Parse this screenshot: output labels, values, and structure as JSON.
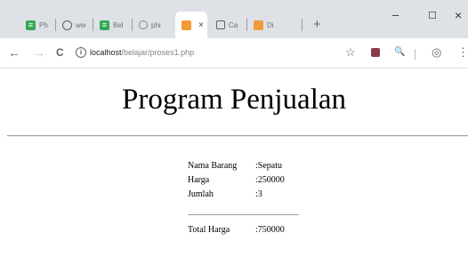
{
  "browser": {
    "tabs": [
      {
        "label": "Ph",
        "color": "#34a853",
        "glyph": "≡",
        "active": false
      },
      {
        "label": "ww",
        "color": "#5f6368",
        "glyph": "◎",
        "active": false
      },
      {
        "label": "Bel",
        "color": "#34a853",
        "glyph": "≡",
        "active": false
      },
      {
        "label": "phi",
        "color": "#5f6368",
        "glyph": "○",
        "active": false
      },
      {
        "label": "",
        "color": "#f29b38",
        "glyph": "",
        "active": true
      },
      {
        "label": "Ca",
        "color": "#5f6368",
        "glyph": "▣",
        "active": false
      },
      {
        "label": "Di",
        "color": "#f29b38",
        "glyph": "",
        "active": false
      }
    ],
    "tab_close": "×",
    "new_tab": "+",
    "window": {
      "minimize": "–",
      "maximize": "☐",
      "close": "×"
    },
    "nav": {
      "back": "←",
      "forward": "→",
      "reload": "C"
    },
    "info_icon": "i",
    "url": {
      "host": "localhost",
      "path": "/belajar/proses1.php"
    },
    "toolbar_icons": {
      "star": "☆",
      "search": "🔍",
      "account": "◎",
      "menu": "⋮"
    }
  },
  "page": {
    "title": "Program Penjualan",
    "fields": [
      {
        "label": "Nama Barang",
        "value": ":Sepatu"
      },
      {
        "label": "Harga",
        "value": ":250000"
      },
      {
        "label": "Jumlah",
        "value": ":3"
      }
    ],
    "total": {
      "label": "Total Harga",
      "value": ":750000"
    }
  }
}
